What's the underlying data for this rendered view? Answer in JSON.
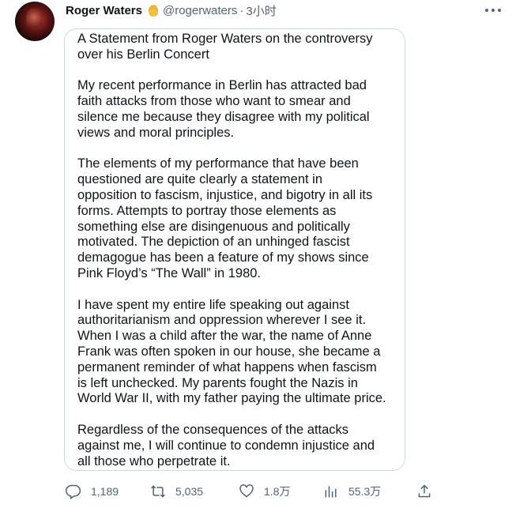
{
  "author": {
    "name": "Roger Waters",
    "handle": "@rogerwaters",
    "separator": "·",
    "time": "3小时"
  },
  "tweet": {
    "paragraphs": [
      "A Statement from Roger Waters on the controversy\nover his Berlin Concert",
      "My recent performance in Berlin has attracted bad\nfaith attacks from those who want to smear and\nsilence me because they disagree with my political\nviews and moral principles.",
      "The elements of my performance that have been\nquestioned are quite clearly a statement in\nopposition to fascism, injustice, and bigotry in all its\nforms. Attempts to portray those elements as\nsomething else are disingenuous and politically\nmotivated. The depiction of an unhinged fascist\ndemagogue has been a feature of my shows since\nPink Floyd’s “The Wall” in 1980.",
      "I have spent my entire life speaking out against\nauthoritarianism and oppression wherever I see it.\nWhen I was a child after the war, the name of Anne\nFrank was often spoken in our house, she became a\npermanent reminder of what happens when fascism\nis left unchecked. My parents fought the Nazis in\nWorld War II, with my father paying the ultimate price.",
      "Regardless of the consequences of the attacks\nagainst me, I will continue to condemn injustice and\nall those who perpetrate it."
    ]
  },
  "actions": {
    "reply_count": "1,189",
    "retweet_count": "5,035",
    "like_count": "1.8万",
    "views_count": "55.3万"
  },
  "icons": {
    "badge": "raised-fist-emoji-icon",
    "more": "more-dots-icon",
    "reply": "reply-icon",
    "retweet": "retweet-icon",
    "like": "heart-icon",
    "views": "views-bar-chart-icon",
    "share": "share-icon"
  },
  "colors": {
    "text": "#0f1419",
    "secondary": "#536471",
    "border": "#cfd9de",
    "badge": "#f6c23c"
  }
}
